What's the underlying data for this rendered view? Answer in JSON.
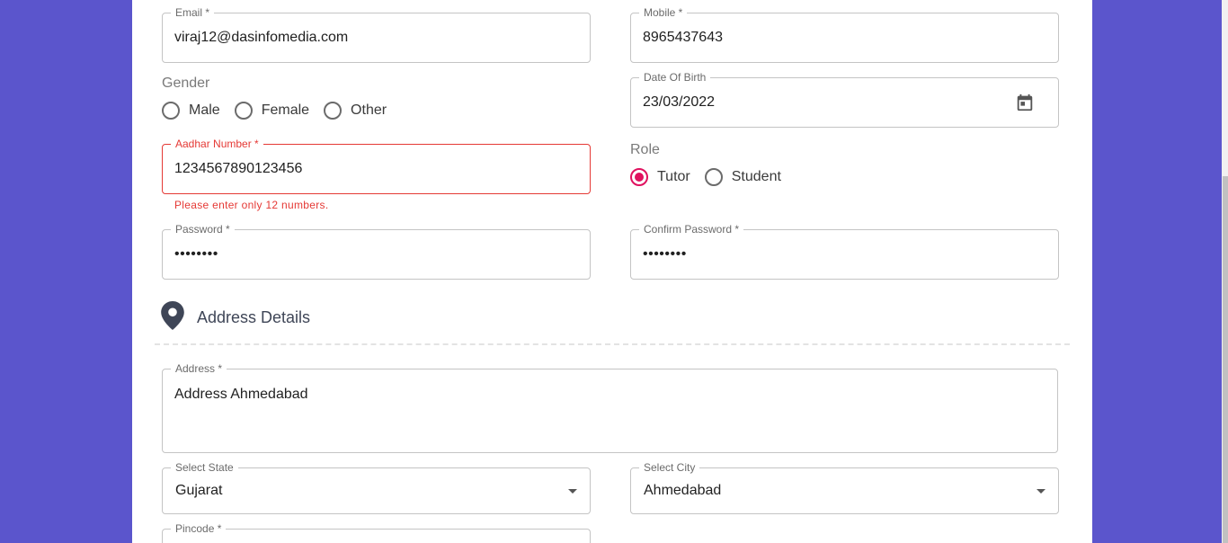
{
  "form": {
    "email": {
      "label": "Email *",
      "value": "viraj12@dasinfomedia.com"
    },
    "mobile": {
      "label": "Mobile *",
      "value": "8965437643"
    },
    "gender": {
      "label": "Gender",
      "options": [
        "Male",
        "Female",
        "Other"
      ],
      "selected": null
    },
    "dob": {
      "label": "Date Of Birth",
      "value": "23/03/2022",
      "icon": "calendar-icon"
    },
    "aadhar": {
      "label": "Aadhar Number *",
      "value": "1234567890123456",
      "error": "Please enter only 12 numbers."
    },
    "role": {
      "label": "Role",
      "options": [
        "Tutor",
        "Student"
      ],
      "selected": "Tutor"
    },
    "password": {
      "label": "Password *",
      "value": "••••••••"
    },
    "confirm_password": {
      "label": "Confirm Password *",
      "value": "••••••••"
    }
  },
  "address_section": {
    "title": "Address Details",
    "icon": "location-pin-icon",
    "address": {
      "label": "Address *",
      "value": "Address Ahmedabad"
    },
    "state": {
      "label": "Select State",
      "value": "Gujarat"
    },
    "city": {
      "label": "Select City",
      "value": "Ahmedabad"
    },
    "pincode": {
      "label": "Pincode *",
      "value": ""
    }
  },
  "colors": {
    "background": "#5b55cc",
    "accent": "#e0115f",
    "error": "#e53935"
  }
}
